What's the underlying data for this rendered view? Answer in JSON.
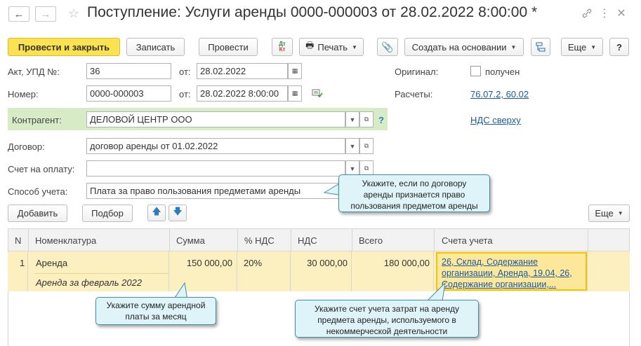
{
  "window": {
    "title": "Поступление: Услуги аренды 0000-000003 от 28.02.2022 8:00:00 *",
    "back_icon": "arrow-left",
    "forward_icon": "arrow-right",
    "favorite_icon": "star",
    "link_icon": "link",
    "menu_icon": "more-vertical",
    "close_icon": "close"
  },
  "toolbar": {
    "post_and_close": "Провести и закрыть",
    "save": "Записать",
    "post": "Провести",
    "dtkt_top": "Дт",
    "dtkt_bottom": "Кт",
    "print": "Печать",
    "create_based_on": "Создать на основании",
    "more": "Еще",
    "help": "?"
  },
  "form": {
    "act_label": "Акт, УПД №:",
    "act_value": "36",
    "from_label": "от:",
    "act_date": "28.02.2022",
    "number_label": "Номер:",
    "number_value": "0000-000003",
    "from_label2": "от:",
    "number_date": "28.02.2022  8:00:00",
    "original_label": "Оригинал:",
    "received_label": "получен",
    "settlements_label": "Расчеты:",
    "settlements_link": "76.07.2, 60.02",
    "counterparty_label": "Контрагент:",
    "counterparty_value": "ДЕЛОВОЙ ЦЕНТР ООО",
    "help_mark": "?",
    "vat_link": "НДС сверху",
    "contract_label": "Договор:",
    "contract_value": "договор аренды от 01.02.2022",
    "invoice_label": "Счет на оплату:",
    "invoice_value": "",
    "accounting_label": "Способ учета:",
    "accounting_value": "Плата за право пользования предметами аренды"
  },
  "table_toolbar": {
    "add": "Добавить",
    "select": "Подбор",
    "more": "Еще"
  },
  "table": {
    "headers": [
      "N",
      "Номенклатура",
      "Сумма",
      "% НДС",
      "НДС",
      "Всего",
      "Счета учета"
    ],
    "rows": [
      {
        "n": "1",
        "item": "Аренда",
        "item_desc": "Аренда за февраль 2022",
        "sum": "150 000,00",
        "vat_rate": "20%",
        "vat": "30 000,00",
        "total": "180 000,00",
        "accounts_1": "26, Склад, Содержание",
        "accounts_2": "организации, Аренда, 19.04, 26,",
        "accounts_3": "Содержание организации,..."
      }
    ]
  },
  "tooltips": {
    "accounting_1": "Укажите, если по договору",
    "accounting_2": "аренды признается право",
    "accounting_3": "пользования предметом аренды",
    "sum_1": "Укажите сумму арендной",
    "sum_2": "платы за месяц",
    "accounts_1": "Укажите счет учета затрат на аренду",
    "accounts_2": "предмета аренды, используемого в",
    "accounts_3": "некоммерческой деятельности"
  },
  "colors": {
    "primary_button": "#fbe250",
    "highlight_row": "#fcefc0",
    "counterparty_bg": "#d7ecc6",
    "tooltip_bg": "#dff4f8",
    "link": "#1c5aa0"
  }
}
